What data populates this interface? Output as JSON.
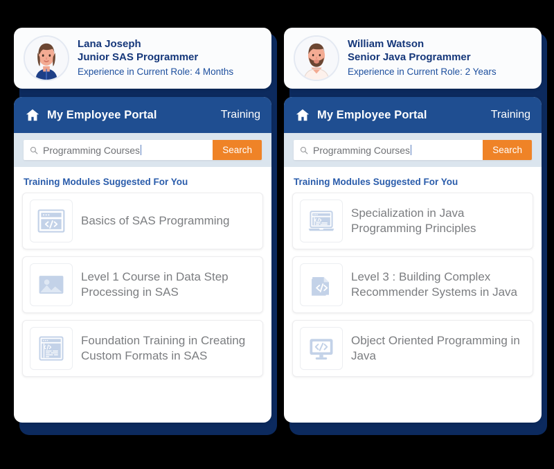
{
  "theme": {
    "page_background": "#000000",
    "shadow_navy": "#0c2a5e",
    "header_blue": "#1f4e91",
    "search_bar_blue": "#dbe5ee",
    "accent_orange": "#ef8327",
    "heading_blue": "#2a5cab",
    "module_text_gray": "#7b7d80"
  },
  "panels": [
    {
      "profile": {
        "avatar_icon": "avatar-woman-icon",
        "name": "Lana Joseph",
        "role": "Junior SAS Programmer",
        "experience": "Experience in Current Role: 4 Months"
      },
      "app": {
        "home_icon": "home-icon",
        "title": "My Employee Portal",
        "nav_label": "Training",
        "search": {
          "icon": "search-icon",
          "value": "Programming Courses",
          "placeholder": "Programming Courses",
          "button_label": "Search"
        },
        "suggest_title": "Training Modules Suggested For You",
        "modules": [
          {
            "icon": "browser-code-icon",
            "title": "Basics of SAS Programming"
          },
          {
            "icon": "image-photo-icon",
            "title": "Level 1 Course in Data Step Processing in SAS"
          },
          {
            "icon": "code-editor-window-icon",
            "title": "Foundation Training in Creating Custom Formats in SAS"
          }
        ]
      }
    },
    {
      "profile": {
        "avatar_icon": "avatar-man-icon",
        "name": "William Watson",
        "role": "Senior Java Programmer",
        "experience": "Experience in Current Role: 2 Years"
      },
      "app": {
        "home_icon": "home-icon",
        "title": "My Employee Portal",
        "nav_label": "Training",
        "search": {
          "icon": "search-icon",
          "value": "Programming Courses",
          "placeholder": "Programming Courses",
          "button_label": "Search"
        },
        "suggest_title": "Training Modules Suggested For You",
        "modules": [
          {
            "icon": "laptop-code-icon",
            "title": "Specialization in Java Programming Principles"
          },
          {
            "icon": "document-code-icon",
            "title": "Level 3 : Building Complex Recommender Systems in Java"
          },
          {
            "icon": "monitor-code-icon",
            "title": "Object Oriented Programming in Java"
          }
        ]
      }
    }
  ]
}
